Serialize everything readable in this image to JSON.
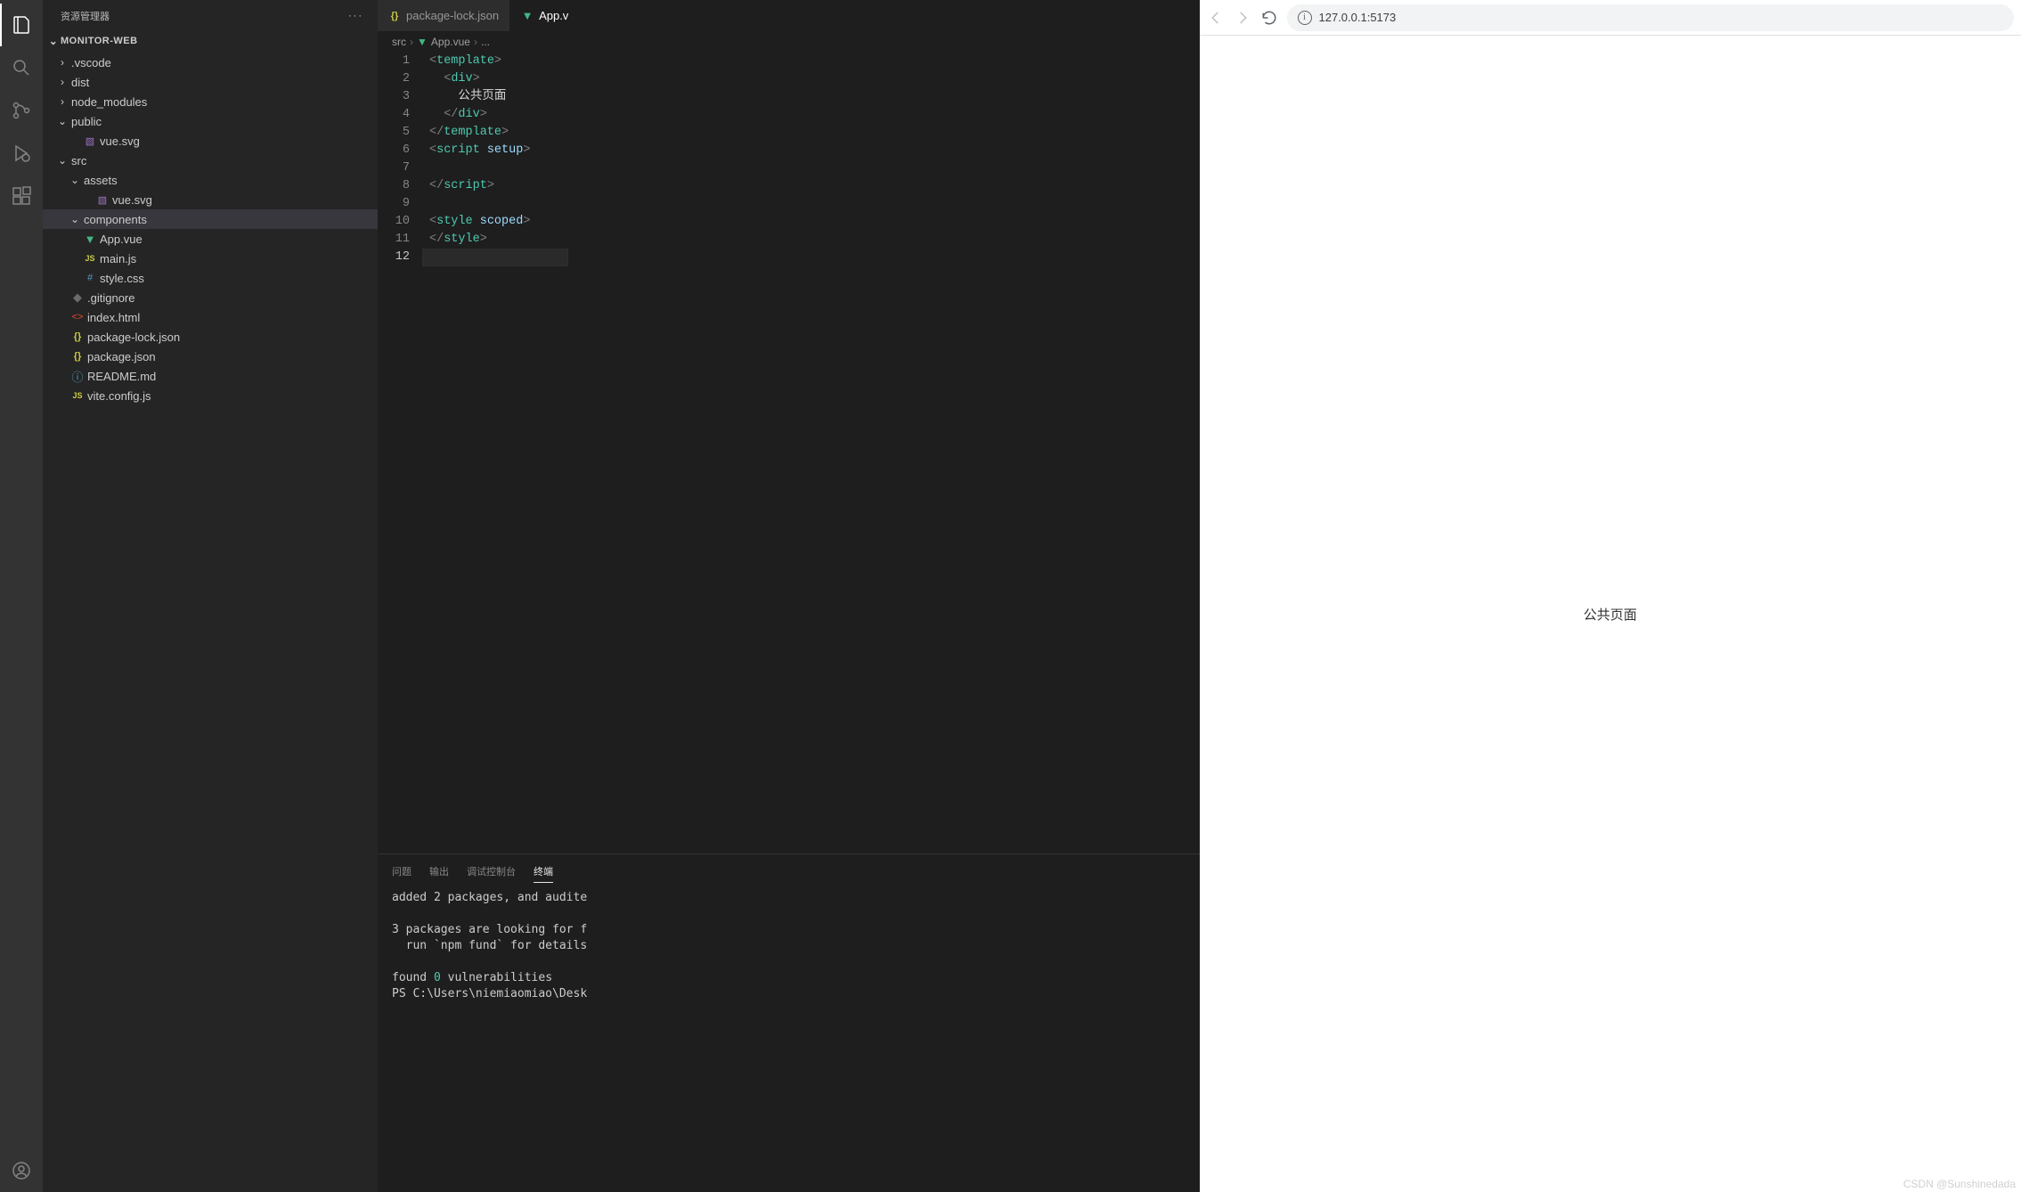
{
  "sidebar": {
    "title": "资源管理器",
    "project": "MONITOR-WEB",
    "tree": [
      {
        "label": ".vscode",
        "type": "folder",
        "depth": 0,
        "expanded": false
      },
      {
        "label": "dist",
        "type": "folder",
        "depth": 0,
        "expanded": false
      },
      {
        "label": "node_modules",
        "type": "folder",
        "depth": 0,
        "expanded": false
      },
      {
        "label": "public",
        "type": "folder",
        "depth": 0,
        "expanded": true
      },
      {
        "label": "vue.svg",
        "type": "file",
        "depth": 1,
        "icon": "svg"
      },
      {
        "label": "src",
        "type": "folder",
        "depth": 0,
        "expanded": true
      },
      {
        "label": "assets",
        "type": "folder",
        "depth": 1,
        "expanded": true
      },
      {
        "label": "vue.svg",
        "type": "file",
        "depth": 2,
        "icon": "svg"
      },
      {
        "label": "components",
        "type": "folder",
        "depth": 1,
        "expanded": true,
        "selected": true
      },
      {
        "label": "App.vue",
        "type": "file",
        "depth": 1,
        "icon": "vue"
      },
      {
        "label": "main.js",
        "type": "file",
        "depth": 1,
        "icon": "js"
      },
      {
        "label": "style.css",
        "type": "file",
        "depth": 1,
        "icon": "css"
      },
      {
        "label": ".gitignore",
        "type": "file",
        "depth": 0,
        "icon": "git"
      },
      {
        "label": "index.html",
        "type": "file",
        "depth": 0,
        "icon": "html"
      },
      {
        "label": "package-lock.json",
        "type": "file",
        "depth": 0,
        "icon": "json"
      },
      {
        "label": "package.json",
        "type": "file",
        "depth": 0,
        "icon": "json"
      },
      {
        "label": "README.md",
        "type": "file",
        "depth": 0,
        "icon": "info"
      },
      {
        "label": "vite.config.js",
        "type": "file",
        "depth": 0,
        "icon": "js"
      }
    ]
  },
  "tabs": [
    {
      "label": "package-lock.json",
      "icon": "json",
      "active": false
    },
    {
      "label": "App.vue",
      "icon": "vue",
      "active": true
    }
  ],
  "breadcrumb": {
    "p1": "src",
    "p2": "App.vue",
    "p3": "..."
  },
  "code": {
    "lines": [
      {
        "n": 1,
        "html": "<span class='tok-tag'>&lt;</span><span class='tok-name'>template</span><span class='tok-tag'>&gt;</span>"
      },
      {
        "n": 2,
        "html": "  <span class='tok-tag'>&lt;</span><span class='tok-name'>div</span><span class='tok-tag'>&gt;</span>"
      },
      {
        "n": 3,
        "html": "    <span class='tok-txt'>公共页面</span>"
      },
      {
        "n": 4,
        "html": "  <span class='tok-tag'>&lt;/</span><span class='tok-name'>div</span><span class='tok-tag'>&gt;</span>"
      },
      {
        "n": 5,
        "html": "<span class='tok-tag'>&lt;/</span><span class='tok-name'>template</span><span class='tok-tag'>&gt;</span>"
      },
      {
        "n": 6,
        "html": "<span class='tok-tag'>&lt;</span><span class='tok-name'>script</span> <span class='tok-attr'>setup</span><span class='tok-tag'>&gt;</span>"
      },
      {
        "n": 7,
        "html": ""
      },
      {
        "n": 8,
        "html": "<span class='tok-tag'>&lt;/</span><span class='tok-name'>script</span><span class='tok-tag'>&gt;</span>"
      },
      {
        "n": 9,
        "html": ""
      },
      {
        "n": 10,
        "html": "<span class='tok-tag'>&lt;</span><span class='tok-name'>style</span> <span class='tok-attr'>scoped</span><span class='tok-tag'>&gt;</span>"
      },
      {
        "n": 11,
        "html": "<span class='tok-tag'>&lt;/</span><span class='tok-name'>style</span><span class='tok-tag'>&gt;</span>"
      },
      {
        "n": 12,
        "html": "",
        "current": true
      }
    ]
  },
  "panel": {
    "tabs": {
      "problems": "问题",
      "output": "输出",
      "debug": "调试控制台",
      "terminal": "终端"
    },
    "active": "终端",
    "lines": [
      "added 2 packages, and audite",
      "",
      "3 packages are looking for f",
      "  run `npm fund` for details",
      "",
      "found <span class='term-num'>0</span> vulnerabilities",
      "PS C:\\Users\\niemiaomiao\\Desk"
    ]
  },
  "browser": {
    "url": "127.0.0.1:5173",
    "content": "公共页面"
  },
  "watermark": "CSDN @Sunshinedada"
}
